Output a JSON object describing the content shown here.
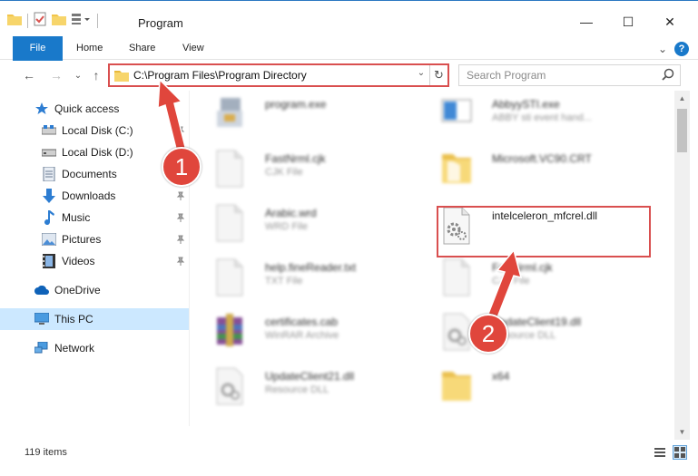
{
  "window": {
    "title": "Program",
    "minimize": "—",
    "maximize": "☐",
    "close": "✕"
  },
  "ribbon": {
    "tabs": [
      {
        "label": "File"
      },
      {
        "label": "Home"
      },
      {
        "label": "Share"
      },
      {
        "label": "View"
      }
    ],
    "collapse": "⌄",
    "help": "?"
  },
  "navigation": {
    "back": "←",
    "forward": "→",
    "recent": "⌄",
    "up": "↑"
  },
  "address": {
    "path": "C:\\Program Files\\Program Directory",
    "dropdown": "⌄",
    "refresh": "↻"
  },
  "search": {
    "placeholder": "Search Program"
  },
  "sidebar": {
    "items": [
      {
        "label": "Quick access",
        "icon": "star-icon"
      },
      {
        "label": "Local Disk (C:)",
        "icon": "drive-icon",
        "pinned": true
      },
      {
        "label": "Local Disk (D:)",
        "icon": "drive-icon"
      },
      {
        "label": "Documents",
        "icon": "documents-icon",
        "pinned": true
      },
      {
        "label": "Downloads",
        "icon": "download-icon",
        "pinned": true
      },
      {
        "label": "Music",
        "icon": "music-icon",
        "pinned": true
      },
      {
        "label": "Pictures",
        "icon": "pictures-icon",
        "pinned": true
      },
      {
        "label": "Videos",
        "icon": "videos-icon",
        "pinned": true
      },
      {
        "label": "OneDrive",
        "icon": "cloud-icon"
      },
      {
        "label": "This PC",
        "icon": "computer-icon",
        "selected": true
      },
      {
        "label": "Network",
        "icon": "network-icon"
      }
    ]
  },
  "files": {
    "left": [
      {
        "name": "program.exe",
        "type": ""
      },
      {
        "name": "FastNrml.cjk",
        "type": "CJK File"
      },
      {
        "name": "Arabic.wrd",
        "type": "WRD File"
      },
      {
        "name": "help.fineReader.txt",
        "type": "TXT File"
      },
      {
        "name": "certificates.cab",
        "type": "WinRAR Archive"
      },
      {
        "name": "UpdateClient21.dll",
        "type": "Resource DLL"
      }
    ],
    "right": [
      {
        "name": "AbbyySTI.exe",
        "type": "ABBY sti event hand..."
      },
      {
        "name": "Microsoft.VC90.CRT",
        "type": ""
      },
      {
        "name": "intelceleron_mfcrel.dll",
        "type": ""
      },
      {
        "name": "FastNrml.cjk",
        "type": "CJK File"
      },
      {
        "name": "UpdateClient19.dll",
        "type": "Resource DLL"
      },
      {
        "name": "x64",
        "type": ""
      }
    ]
  },
  "status": {
    "item_count": "119 items"
  },
  "callouts": {
    "one": "1",
    "two": "2"
  },
  "colors": {
    "accent": "#1979ca",
    "highlight": "#d94f4f",
    "callout": "#e0463c",
    "selected": "#cce8ff"
  }
}
